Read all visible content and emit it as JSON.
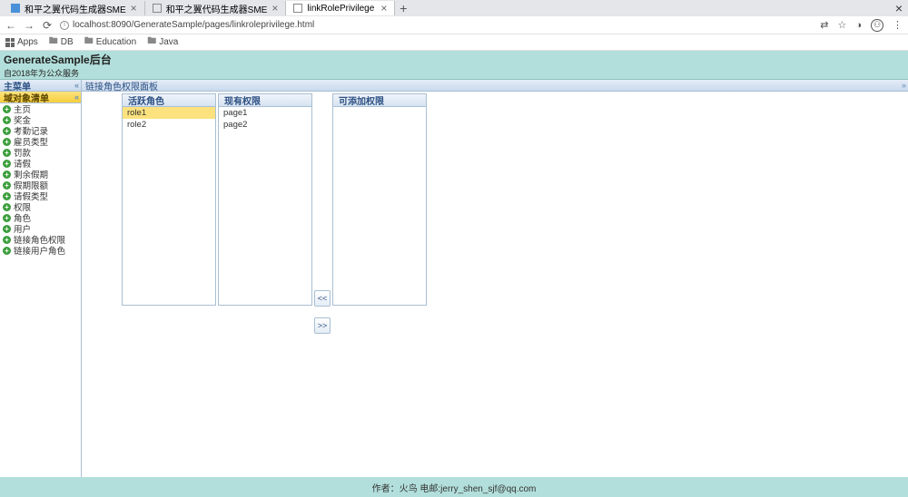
{
  "tabs": [
    {
      "title": "和平之翼代码生成器SME",
      "active": false
    },
    {
      "title": "和平之翼代码生成器SME",
      "active": false
    },
    {
      "title": "linkRolePrivilege",
      "active": true
    }
  ],
  "url": "localhost:8090/GenerateSample/pages/linkroleprivilege.html",
  "bookmarks": {
    "apps": "Apps",
    "items": [
      "DB",
      "Education",
      "Java"
    ]
  },
  "app": {
    "title": "GenerateSample后台",
    "subtitle": "自2018年为公众服务"
  },
  "sidebar": {
    "main_header": "主菜单",
    "domain_header": "域对象清单",
    "items": [
      "主页",
      "奖金",
      "考勤记录",
      "雇员类型",
      "罚款",
      "请假",
      "剩余假期",
      "假期限额",
      "请假类型",
      "权限",
      "角色",
      "用户",
      "链接角色权限",
      "链接用户角色"
    ]
  },
  "main": {
    "header": "链接角色权限面板",
    "panels": {
      "roles": {
        "title": "活跃角色",
        "rows": [
          "role1",
          "role2"
        ],
        "selected": 0
      },
      "owned": {
        "title": "现有权限",
        "rows": [
          "page1",
          "page2"
        ]
      },
      "avail": {
        "title": "可添加权限",
        "rows": []
      }
    },
    "buttons": {
      "left": "<<",
      "right": ">>"
    }
  },
  "footer": "作者：火鸟 电邮:jerry_shen_sjf@qq.com"
}
